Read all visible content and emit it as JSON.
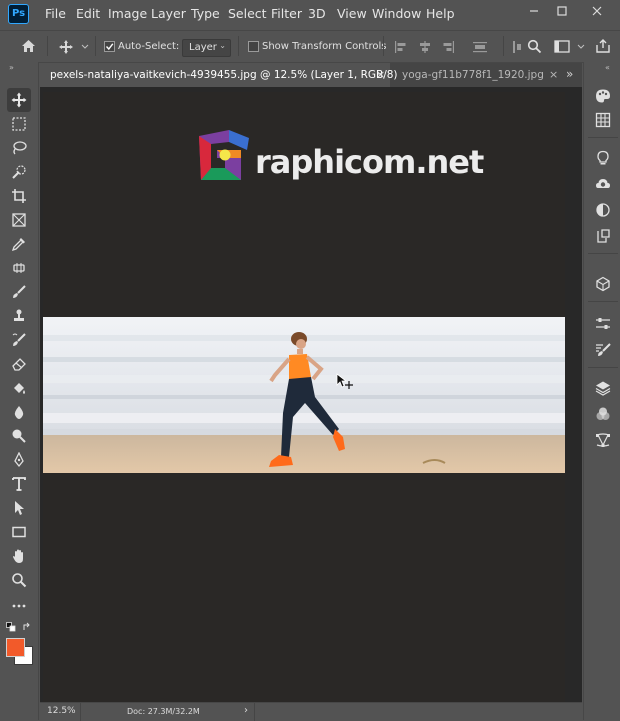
{
  "app": {
    "logo_text": "Ps"
  },
  "menu": [
    "File",
    "Edit",
    "Image",
    "Layer",
    "Type",
    "Select",
    "Filter",
    "3D",
    "View",
    "Window",
    "Help"
  ],
  "options": {
    "auto_select_label": "Auto-Select:",
    "auto_select_checked": true,
    "layer_select_value": "Layer",
    "transform_controls_label": "Show Transform Controls",
    "transform_controls_checked": false
  },
  "tabs": [
    {
      "label": "pexels-nataliya-vaitkevich-4939455.jpg @ 12.5% (Layer 1, RGB/8)",
      "close": "×",
      "active": true
    },
    {
      "label": "yoga-gf11b778f1_1920.jpg",
      "close": "×",
      "active": false
    }
  ],
  "tabs_overflow": "»",
  "canvas": {
    "watermark_text": "raphicom.net"
  },
  "status": {
    "zoom": "12.5%",
    "doc_info": "Doc: 27.3M/32.2M",
    "arrow": "›"
  },
  "colors": {
    "foreground": "#f25a2a",
    "background": "#ffffff",
    "accent": "#31a8ff",
    "ui_bg": "#535353",
    "canvas_bg": "#282828"
  },
  "tools": [
    "move-tool",
    "marquee-tool",
    "lasso-tool",
    "quick-selection-tool",
    "crop-tool",
    "frame-tool",
    "eyedropper-tool",
    "spot-healing-tool",
    "brush-tool",
    "clone-stamp-tool",
    "history-brush-tool",
    "eraser-tool",
    "paint-bucket-tool",
    "blur-tool",
    "dodge-tool",
    "pen-tool",
    "type-tool",
    "path-selection-tool",
    "rectangle-tool",
    "hand-tool",
    "zoom-tool",
    "more-tools"
  ],
  "panels": [
    "color-panel",
    "swatches-panel",
    "learn-panel",
    "libraries-panel",
    "adjustments-panel",
    "history-panel",
    "3d-panel",
    "properties-panel",
    "brush-settings-panel",
    "layers-panel",
    "channels-panel",
    "paths-panel"
  ]
}
